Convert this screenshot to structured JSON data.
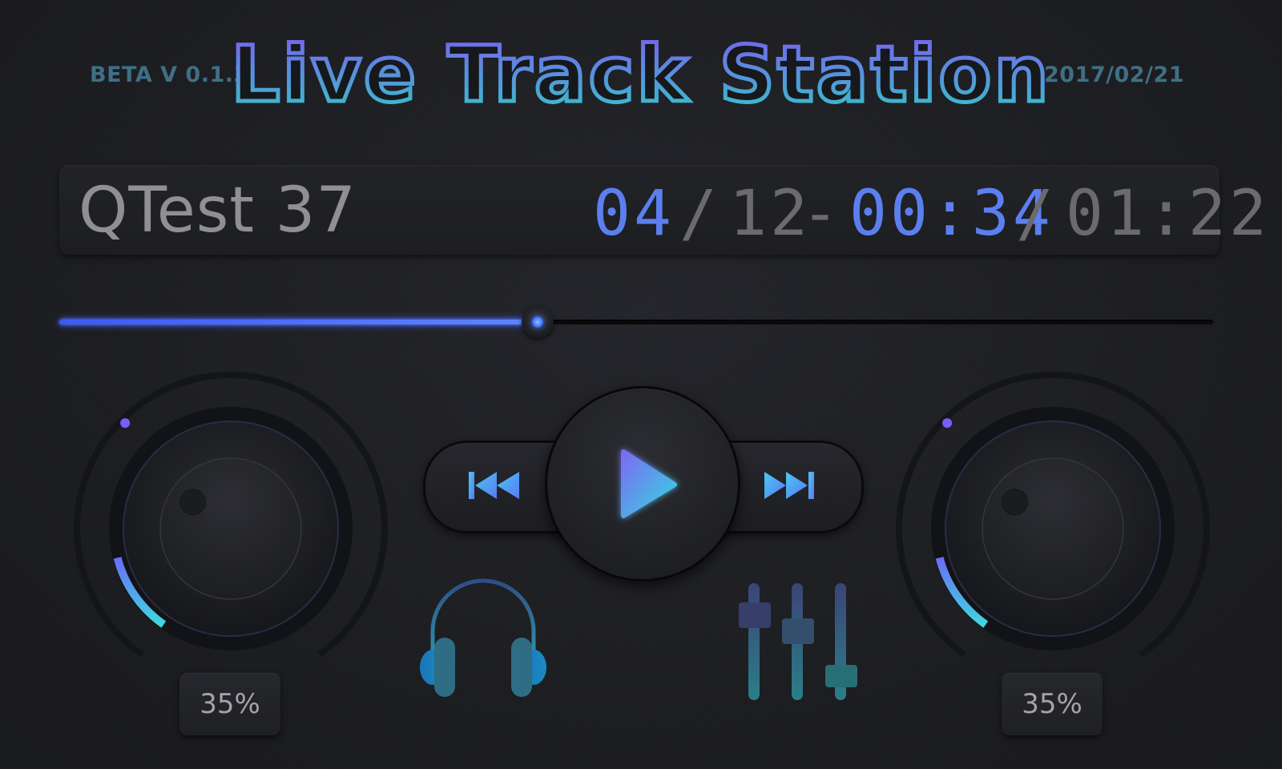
{
  "header": {
    "version": "BETA V 0.1.3",
    "title": "Live Track Station",
    "date": "2017/02/21"
  },
  "display": {
    "track_name": "QTest 37",
    "track_index": "04",
    "track_separator": "/",
    "track_total": "12",
    "dash": "-",
    "elapsed": "00:34",
    "time_separator": "/",
    "duration": "01:22"
  },
  "progress": {
    "fraction": 0.4146
  },
  "knobs": [
    {
      "label": "35%",
      "value": 0.35
    },
    {
      "label": "35%",
      "value": 0.35
    }
  ],
  "icons": {
    "prev": "skip-previous-icon",
    "play": "play-icon",
    "next": "skip-next-icon",
    "headphones": "headphones-icon",
    "mixer": "equalizer-icon"
  },
  "colors": {
    "accent_blue": "#5b7ff0",
    "accent_cyan": "#3fd6d9",
    "accent_purple": "#7b5cf0"
  }
}
